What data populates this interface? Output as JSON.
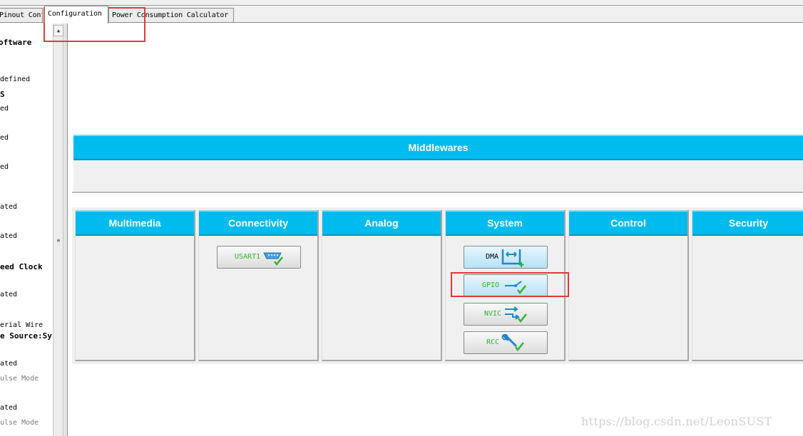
{
  "tabs": [
    {
      "label": "Pinout Configuration"
    },
    {
      "label": "Configuration"
    },
    {
      "label": "Power Consumption Calculator"
    }
  ],
  "left_tree": [
    {
      "text": "oftware",
      "style": "b"
    },
    {
      "text": "defined",
      "style": ""
    },
    {
      "text": "S",
      "style": "b"
    },
    {
      "text": "ed",
      "style": ""
    },
    {
      "text": "ed",
      "style": ""
    },
    {
      "text": "ed",
      "style": ""
    },
    {
      "text": "ated",
      "style": ""
    },
    {
      "text": "ated",
      "style": ""
    },
    {
      "text": "eed Clock",
      "style": "b"
    },
    {
      "text": "ated",
      "style": ""
    },
    {
      "text": "erial Wire",
      "style": ""
    },
    {
      "text": "e Source:Sy",
      "style": "b"
    },
    {
      "text": "ated",
      "style": ""
    },
    {
      "text": "ulse Mode",
      "style": "g"
    },
    {
      "text": "ated",
      "style": ""
    },
    {
      "text": "ulse Mode",
      "style": "g"
    }
  ],
  "scroll": {
    "up_glyph": "▲",
    "grip_glyph": "≡"
  },
  "middlewares": {
    "title": "Middlewares"
  },
  "categories": [
    {
      "title": "Multimedia"
    },
    {
      "title": "Connectivity"
    },
    {
      "title": "Analog"
    },
    {
      "title": "System"
    },
    {
      "title": "Control"
    },
    {
      "title": "Security"
    }
  ],
  "buttons": {
    "usart1": "USART1",
    "dma": "DMA",
    "gpio": "GPIO",
    "nvic": "NVIC",
    "rcc": "RCC"
  },
  "colors": {
    "header_blue": "#00bbee",
    "highlight_red": "#e23a3a",
    "status_green": "#2fb52f"
  },
  "watermark": "https://blog.csdn.net/LeonSUST"
}
